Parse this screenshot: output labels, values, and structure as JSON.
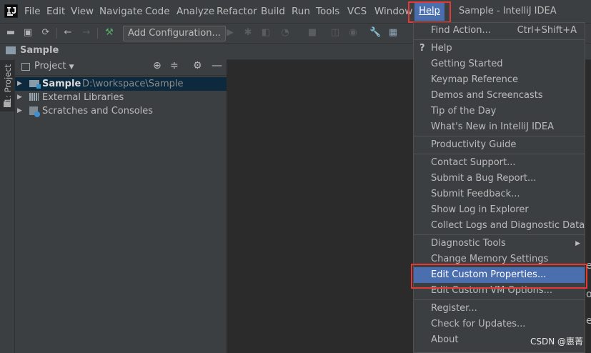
{
  "menubar": {
    "items": [
      "File",
      "Edit",
      "View",
      "Navigate",
      "Code",
      "Analyze",
      "Refactor",
      "Build",
      "Run",
      "Tools",
      "VCS",
      "Window"
    ],
    "help_label": "Help",
    "window_title": "Sample - IntelliJ IDEA"
  },
  "toolbar": {
    "add_configuration_label": "Add Configuration...",
    "icons": [
      "folder-open-icon",
      "save-icon",
      "sync-icon",
      "back-icon",
      "forward-icon",
      "build-hammer-icon",
      "run-icon",
      "debug-icon",
      "coverage-icon",
      "profile-icon",
      "stop-icon",
      "vcs-update-icon",
      "vcs-commit-icon",
      "settings-wrench-icon",
      "project-structure-icon"
    ]
  },
  "navbar": {
    "project_label": "Sample"
  },
  "stripe": {
    "tab_label": "1: Project"
  },
  "project_panel": {
    "title": "Project",
    "tree": [
      {
        "name": "Sample",
        "path": "D:\\workspace\\Sample",
        "selected": true
      },
      {
        "name": "External Libraries"
      },
      {
        "name": "Scratches and Consoles"
      }
    ]
  },
  "help_menu": {
    "groups": [
      [
        {
          "label": "Find Action...",
          "shortcut": "Ctrl+Shift+A"
        }
      ],
      [
        {
          "label": "Help",
          "icon": "question-icon"
        },
        {
          "label": "Getting Started"
        },
        {
          "label": "Keymap Reference"
        },
        {
          "label": "Demos and Screencasts"
        },
        {
          "label": "Tip of the Day"
        },
        {
          "label": "What's New in IntelliJ IDEA"
        }
      ],
      [
        {
          "label": "Productivity Guide"
        }
      ],
      [
        {
          "label": "Contact Support..."
        },
        {
          "label": "Submit a Bug Report..."
        },
        {
          "label": "Submit Feedback..."
        },
        {
          "label": "Show Log in Explorer"
        },
        {
          "label": "Collect Logs and Diagnostic Data"
        }
      ],
      [
        {
          "label": "Diagnostic Tools",
          "submenu": true
        },
        {
          "label": "Change Memory Settings"
        },
        {
          "label": "Edit Custom Properties...",
          "highlighted": true
        },
        {
          "label": "Edit Custom VM Options..."
        }
      ],
      [
        {
          "label": "Register..."
        },
        {
          "label": "Check for Updates..."
        },
        {
          "label": "About"
        }
      ]
    ]
  },
  "watermark": "CSDN @惠菁",
  "colors": {
    "highlight": "#4b6eaf",
    "annotation_red": "#e53935",
    "background": "#2b2b2b",
    "panel": "#3c3f41"
  }
}
